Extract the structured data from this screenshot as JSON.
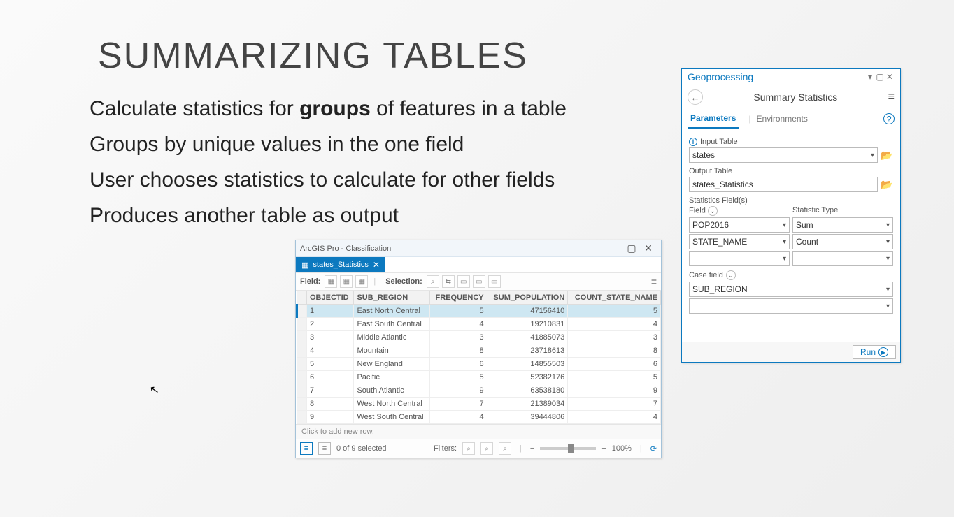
{
  "slide": {
    "title": "SUMMARIZING TABLES",
    "line1a": "Calculate statistics for ",
    "line1b": "groups",
    "line1c": " of features in a table",
    "line2": "Groups by unique values in the one field",
    "line3": "User chooses statistics to calculate for other fields",
    "line4": "Produces another table as output"
  },
  "tablewin": {
    "app": "ArcGIS Pro - Classification",
    "tab": "states_Statistics",
    "toolbar": {
      "field": "Field:",
      "selection": "Selection:"
    },
    "cols": [
      "OBJECTID",
      "SUB_REGION",
      "FREQUENCY",
      "SUM_POPULATION",
      "COUNT_STATE_NAME"
    ],
    "rows": [
      {
        "id": "1",
        "region": "East North Central",
        "freq": "5",
        "sum": "47156410",
        "count": "5"
      },
      {
        "id": "2",
        "region": "East South Central",
        "freq": "4",
        "sum": "19210831",
        "count": "4"
      },
      {
        "id": "3",
        "region": "Middle Atlantic",
        "freq": "3",
        "sum": "41885073",
        "count": "3"
      },
      {
        "id": "4",
        "region": "Mountain",
        "freq": "8",
        "sum": "23718613",
        "count": "8"
      },
      {
        "id": "5",
        "region": "New England",
        "freq": "6",
        "sum": "14855503",
        "count": "6"
      },
      {
        "id": "6",
        "region": "Pacific",
        "freq": "5",
        "sum": "52382176",
        "count": "5"
      },
      {
        "id": "7",
        "region": "South Atlantic",
        "freq": "9",
        "sum": "63538180",
        "count": "9"
      },
      {
        "id": "8",
        "region": "West North Central",
        "freq": "7",
        "sum": "21389034",
        "count": "7"
      },
      {
        "id": "9",
        "region": "West South Central",
        "freq": "4",
        "sum": "39444806",
        "count": "4"
      }
    ],
    "addrow": "Click to add new row.",
    "status": {
      "selected": "0 of 9 selected",
      "filters": "Filters:",
      "zoom": "100%"
    }
  },
  "gp": {
    "pane": "Geoprocessing",
    "tool": "Summary Statistics",
    "tabs": {
      "params": "Parameters",
      "env": "Environments"
    },
    "labels": {
      "input": "Input Table",
      "output": "Output Table",
      "stats": "Statistics Field(s)",
      "field": "Field",
      "stattype": "Statistic Type",
      "casefield": "Case field"
    },
    "values": {
      "input": "states",
      "output": "states_Statistics",
      "f1": "POP2016",
      "s1": "Sum",
      "f2": "STATE_NAME",
      "s2": "Count",
      "case": "SUB_REGION"
    },
    "run": "Run"
  }
}
